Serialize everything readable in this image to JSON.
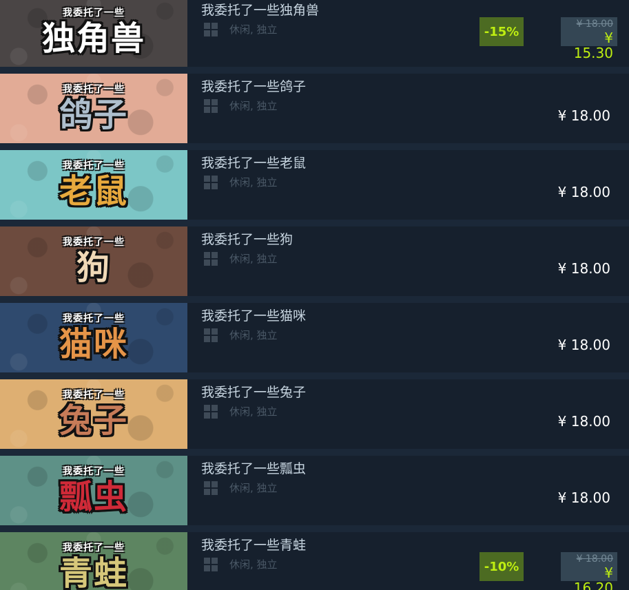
{
  "games": [
    {
      "title": "我委托了一些独角兽",
      "tags": "休闲, 独立",
      "platform_icon": "windows-icon",
      "capsule": {
        "sub": "我委托了一些",
        "main": "独角兽",
        "bg": "#4a4545",
        "text_color": "#ffffff"
      },
      "discount": "-15%",
      "original_price": "¥ 18.00",
      "price": "¥ 15.30"
    },
    {
      "title": "我委托了一些鸽子",
      "tags": "休闲, 独立",
      "platform_icon": "windows-icon",
      "capsule": {
        "sub": "我委托了一些",
        "main": "鸽子",
        "bg": "#e2ab96",
        "text_color": "#aebfcd"
      },
      "discount": null,
      "original_price": null,
      "price": "¥ 18.00"
    },
    {
      "title": "我委托了一些老鼠",
      "tags": "休闲, 独立",
      "platform_icon": "windows-icon",
      "capsule": {
        "sub": "我委托了一些",
        "main": "老鼠",
        "bg": "#7cc6c6",
        "text_color": "#e7a93d"
      },
      "discount": null,
      "original_price": null,
      "price": "¥ 18.00"
    },
    {
      "title": "我委托了一些狗",
      "tags": "休闲, 独立",
      "platform_icon": "windows-icon",
      "capsule": {
        "sub": "我委托了一些",
        "main": "狗",
        "bg": "#6d4b3e",
        "text_color": "#f0d9b7"
      },
      "discount": null,
      "original_price": null,
      "price": "¥ 18.00"
    },
    {
      "title": "我委托了一些猫咪",
      "tags": "休闲, 独立",
      "platform_icon": "windows-icon",
      "capsule": {
        "sub": "我委托了一些",
        "main": "猫咪",
        "bg": "#2f4a6e",
        "text_color": "#e59448"
      },
      "discount": null,
      "original_price": null,
      "price": "¥ 18.00"
    },
    {
      "title": "我委托了一些兔子",
      "tags": "休闲, 独立",
      "platform_icon": "windows-icon",
      "capsule": {
        "sub": "我委托了一些",
        "main": "兔子",
        "bg": "#deaf72",
        "text_color": "#c77b58"
      },
      "discount": null,
      "original_price": null,
      "price": "¥ 18.00"
    },
    {
      "title": "我委托了一些瓢虫",
      "tags": "休闲, 独立",
      "platform_icon": "windows-icon",
      "capsule": {
        "sub": "我委托了一些",
        "main": "瓢虫",
        "bg": "#5e9187",
        "text_color": "#cf2a38"
      },
      "discount": null,
      "original_price": null,
      "price": "¥ 18.00"
    },
    {
      "title": "我委托了一些青蛙",
      "tags": "休闲, 独立",
      "platform_icon": "windows-icon",
      "capsule": {
        "sub": "我委托了一些",
        "main": "青蛙",
        "bg": "#5d8561",
        "text_color": "#d6c77a"
      },
      "discount": "-10%",
      "original_price": "¥ 18.00",
      "price": "¥ 16.20"
    }
  ]
}
